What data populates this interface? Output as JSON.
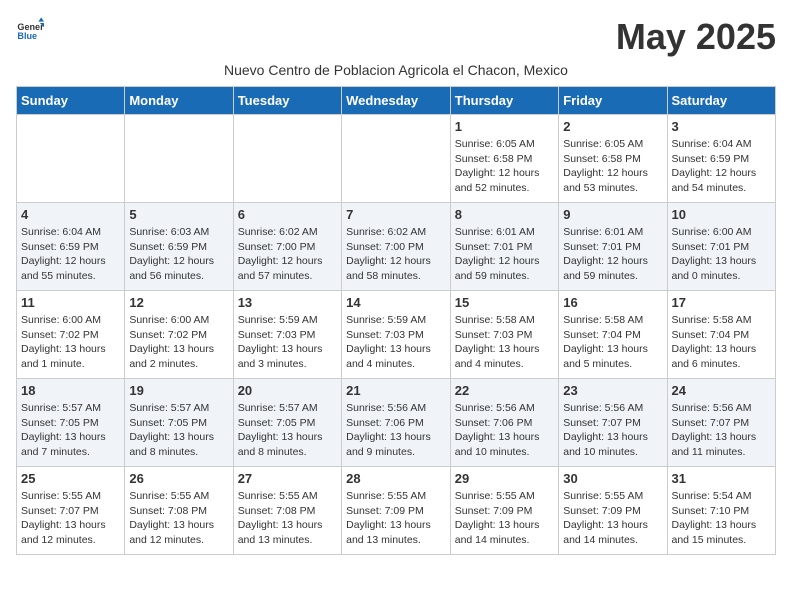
{
  "header": {
    "logo_general": "General",
    "logo_blue": "Blue",
    "month_title": "May 2025",
    "subtitle": "Nuevo Centro de Poblacion Agricola el Chacon, Mexico"
  },
  "days_of_week": [
    "Sunday",
    "Monday",
    "Tuesday",
    "Wednesday",
    "Thursday",
    "Friday",
    "Saturday"
  ],
  "weeks": [
    [
      {
        "date": "",
        "info": ""
      },
      {
        "date": "",
        "info": ""
      },
      {
        "date": "",
        "info": ""
      },
      {
        "date": "",
        "info": ""
      },
      {
        "date": "1",
        "info": "Sunrise: 6:05 AM\nSunset: 6:58 PM\nDaylight: 12 hours\nand 52 minutes."
      },
      {
        "date": "2",
        "info": "Sunrise: 6:05 AM\nSunset: 6:58 PM\nDaylight: 12 hours\nand 53 minutes."
      },
      {
        "date": "3",
        "info": "Sunrise: 6:04 AM\nSunset: 6:59 PM\nDaylight: 12 hours\nand 54 minutes."
      }
    ],
    [
      {
        "date": "4",
        "info": "Sunrise: 6:04 AM\nSunset: 6:59 PM\nDaylight: 12 hours\nand 55 minutes."
      },
      {
        "date": "5",
        "info": "Sunrise: 6:03 AM\nSunset: 6:59 PM\nDaylight: 12 hours\nand 56 minutes."
      },
      {
        "date": "6",
        "info": "Sunrise: 6:02 AM\nSunset: 7:00 PM\nDaylight: 12 hours\nand 57 minutes."
      },
      {
        "date": "7",
        "info": "Sunrise: 6:02 AM\nSunset: 7:00 PM\nDaylight: 12 hours\nand 58 minutes."
      },
      {
        "date": "8",
        "info": "Sunrise: 6:01 AM\nSunset: 7:01 PM\nDaylight: 12 hours\nand 59 minutes."
      },
      {
        "date": "9",
        "info": "Sunrise: 6:01 AM\nSunset: 7:01 PM\nDaylight: 12 hours\nand 59 minutes."
      },
      {
        "date": "10",
        "info": "Sunrise: 6:00 AM\nSunset: 7:01 PM\nDaylight: 13 hours\nand 0 minutes."
      }
    ],
    [
      {
        "date": "11",
        "info": "Sunrise: 6:00 AM\nSunset: 7:02 PM\nDaylight: 13 hours\nand 1 minute."
      },
      {
        "date": "12",
        "info": "Sunrise: 6:00 AM\nSunset: 7:02 PM\nDaylight: 13 hours\nand 2 minutes."
      },
      {
        "date": "13",
        "info": "Sunrise: 5:59 AM\nSunset: 7:03 PM\nDaylight: 13 hours\nand 3 minutes."
      },
      {
        "date": "14",
        "info": "Sunrise: 5:59 AM\nSunset: 7:03 PM\nDaylight: 13 hours\nand 4 minutes."
      },
      {
        "date": "15",
        "info": "Sunrise: 5:58 AM\nSunset: 7:03 PM\nDaylight: 13 hours\nand 4 minutes."
      },
      {
        "date": "16",
        "info": "Sunrise: 5:58 AM\nSunset: 7:04 PM\nDaylight: 13 hours\nand 5 minutes."
      },
      {
        "date": "17",
        "info": "Sunrise: 5:58 AM\nSunset: 7:04 PM\nDaylight: 13 hours\nand 6 minutes."
      }
    ],
    [
      {
        "date": "18",
        "info": "Sunrise: 5:57 AM\nSunset: 7:05 PM\nDaylight: 13 hours\nand 7 minutes."
      },
      {
        "date": "19",
        "info": "Sunrise: 5:57 AM\nSunset: 7:05 PM\nDaylight: 13 hours\nand 8 minutes."
      },
      {
        "date": "20",
        "info": "Sunrise: 5:57 AM\nSunset: 7:05 PM\nDaylight: 13 hours\nand 8 minutes."
      },
      {
        "date": "21",
        "info": "Sunrise: 5:56 AM\nSunset: 7:06 PM\nDaylight: 13 hours\nand 9 minutes."
      },
      {
        "date": "22",
        "info": "Sunrise: 5:56 AM\nSunset: 7:06 PM\nDaylight: 13 hours\nand 10 minutes."
      },
      {
        "date": "23",
        "info": "Sunrise: 5:56 AM\nSunset: 7:07 PM\nDaylight: 13 hours\nand 10 minutes."
      },
      {
        "date": "24",
        "info": "Sunrise: 5:56 AM\nSunset: 7:07 PM\nDaylight: 13 hours\nand 11 minutes."
      }
    ],
    [
      {
        "date": "25",
        "info": "Sunrise: 5:55 AM\nSunset: 7:07 PM\nDaylight: 13 hours\nand 12 minutes."
      },
      {
        "date": "26",
        "info": "Sunrise: 5:55 AM\nSunset: 7:08 PM\nDaylight: 13 hours\nand 12 minutes."
      },
      {
        "date": "27",
        "info": "Sunrise: 5:55 AM\nSunset: 7:08 PM\nDaylight: 13 hours\nand 13 minutes."
      },
      {
        "date": "28",
        "info": "Sunrise: 5:55 AM\nSunset: 7:09 PM\nDaylight: 13 hours\nand 13 minutes."
      },
      {
        "date": "29",
        "info": "Sunrise: 5:55 AM\nSunset: 7:09 PM\nDaylight: 13 hours\nand 14 minutes."
      },
      {
        "date": "30",
        "info": "Sunrise: 5:55 AM\nSunset: 7:09 PM\nDaylight: 13 hours\nand 14 minutes."
      },
      {
        "date": "31",
        "info": "Sunrise: 5:54 AM\nSunset: 7:10 PM\nDaylight: 13 hours\nand 15 minutes."
      }
    ]
  ]
}
